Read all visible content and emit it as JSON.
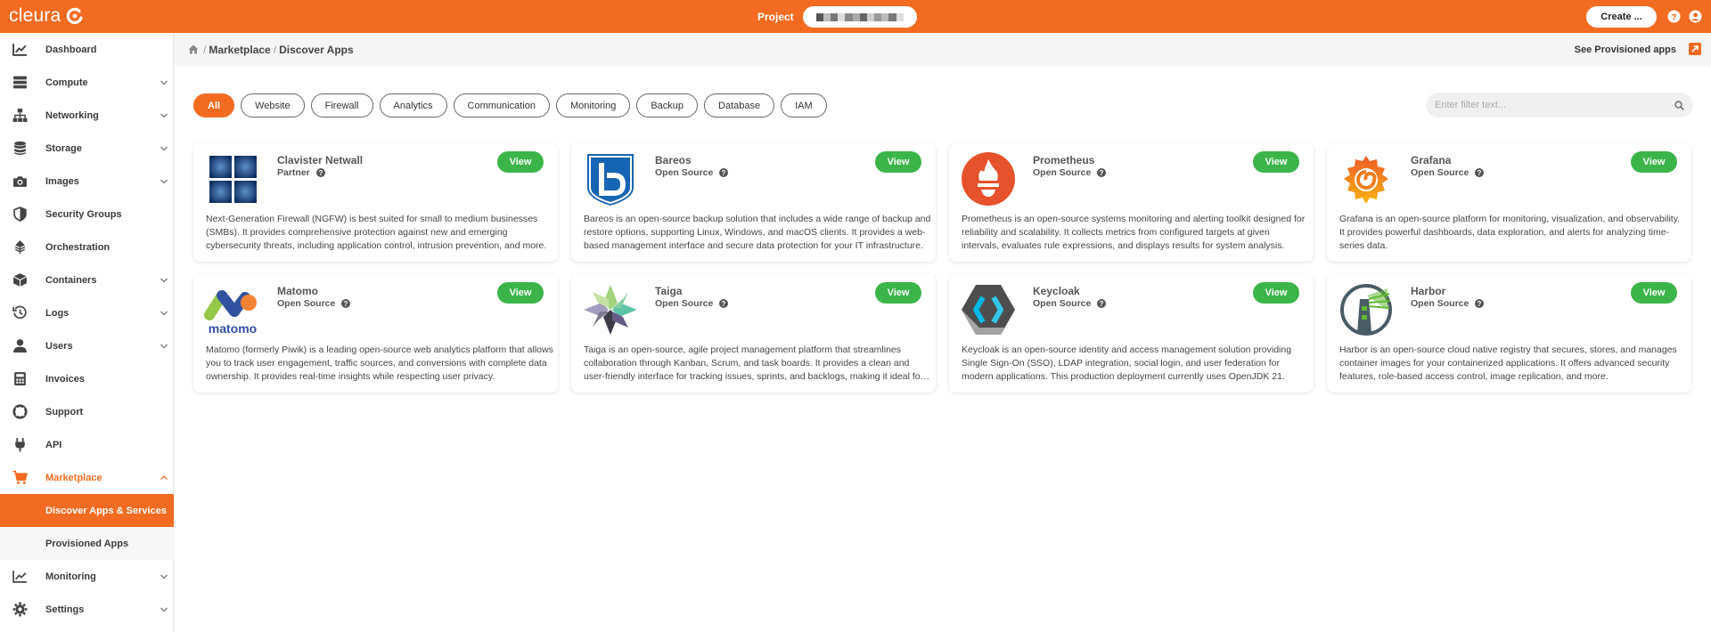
{
  "app": {
    "logo_text": "cleura",
    "brand_color": "#f26b21"
  },
  "topbar": {
    "project_label": "Project",
    "create_label": "Create ...",
    "icons": [
      "help-circle-icon",
      "user-circle-icon"
    ]
  },
  "sidebar": {
    "items": [
      {
        "label": "Dashboard",
        "icon": "chart-icon",
        "has_chevron": false
      },
      {
        "label": "Compute",
        "icon": "server-icon",
        "has_chevron": true
      },
      {
        "label": "Networking",
        "icon": "network-icon",
        "has_chevron": true
      },
      {
        "label": "Storage",
        "icon": "database-icon",
        "has_chevron": true
      },
      {
        "label": "Images",
        "icon": "camera-icon",
        "has_chevron": true
      },
      {
        "label": "Security Groups",
        "icon": "shield-icon",
        "has_chevron": false
      },
      {
        "label": "Orchestration",
        "icon": "orchestration-icon",
        "has_chevron": false
      },
      {
        "label": "Containers",
        "icon": "box-icon",
        "has_chevron": true
      },
      {
        "label": "Logs",
        "icon": "history-icon",
        "has_chevron": true
      },
      {
        "label": "Users",
        "icon": "user-icon",
        "has_chevron": true
      },
      {
        "label": "Invoices",
        "icon": "calculator-icon",
        "has_chevron": false
      },
      {
        "label": "Support",
        "icon": "lifebuoy-icon",
        "has_chevron": false
      },
      {
        "label": "API",
        "icon": "plug-icon",
        "has_chevron": false
      },
      {
        "label": "Marketplace",
        "icon": "cart-icon",
        "has_chevron": true,
        "expanded": true
      },
      {
        "label": "Monitoring",
        "icon": "trend-icon",
        "has_chevron": true
      },
      {
        "label": "Settings",
        "icon": "gear-icon",
        "has_chevron": true
      }
    ],
    "sub_items": [
      {
        "label": "Discover Apps & Services",
        "selected": true
      },
      {
        "label": "Provisioned Apps",
        "selected": false
      }
    ]
  },
  "breadcrumb": {
    "parent": "Marketplace",
    "current": "Discover Apps",
    "see_provisioned": "See Provisioned apps"
  },
  "filters": [
    "All",
    "Website",
    "Firewall",
    "Analytics",
    "Communication",
    "Monitoring",
    "Backup",
    "Database",
    "IAM"
  ],
  "active_filter": "All",
  "search": {
    "placeholder": "Enter filter text...",
    "value": ""
  },
  "view_label": "View",
  "apps": [
    {
      "name": "Clavister Netwall",
      "type": "Partner",
      "logo": "clavister-logo",
      "description": "Next-Generation Firewall (NGFW) is best suited for small to medium businesses (SMBs). It provides comprehensive protection against new and emerging cybersecurity threats, including application control, intrusion prevention, and more."
    },
    {
      "name": "Bareos",
      "type": "Open Source",
      "logo": "bareos-logo",
      "description": "Bareos is an open-source backup solution that includes a wide range of backup and restore options, supporting Linux, Windows, and macOS clients. It provides a web-based management interface and secure data protection for your IT infrastructure."
    },
    {
      "name": "Prometheus",
      "type": "Open Source",
      "logo": "prometheus-logo",
      "description": "Prometheus is an open-source systems monitoring and alerting toolkit designed for reliability and scalability. It collects metrics from configured targets at given intervals, evaluates rule expressions, and displays results for system analysis."
    },
    {
      "name": "Grafana",
      "type": "Open Source",
      "logo": "grafana-logo",
      "description": "Grafana is an open-source platform for monitoring, visualization, and observability. It provides powerful dashboards, data exploration, and alerts for analyzing time-series data."
    },
    {
      "name": "Matomo",
      "type": "Open Source",
      "logo": "matomo-logo",
      "description": "Matomo (formerly Piwik) is a leading open-source web analytics platform that allows you to track user engagement, traffic sources, and conversions with complete data ownership. It provides real-time insights while respecting user privacy."
    },
    {
      "name": "Taiga",
      "type": "Open Source",
      "logo": "taiga-logo",
      "description": "Taiga is an open-source, agile project management platform that streamlines collaboration through Kanban, Scrum, and task boards. It provides a clean and user-friendly interface for tracking issues, sprints, and backlogs, making it ideal for teams."
    },
    {
      "name": "Keycloak",
      "type": "Open Source",
      "logo": "keycloak-logo",
      "description": "Keycloak is an open-source identity and access management solution providing Single Sign-On (SSO), LDAP integration, social login, and user federation for modern applications. This production deployment currently uses OpenJDK 21."
    },
    {
      "name": "Harbor",
      "type": "Open Source",
      "logo": "harbor-logo",
      "description": "Harbor is an open-source cloud native registry that secures, stores, and manages container images for your containerized applications. It offers advanced security features, role-based access control, image replication, and more."
    }
  ]
}
